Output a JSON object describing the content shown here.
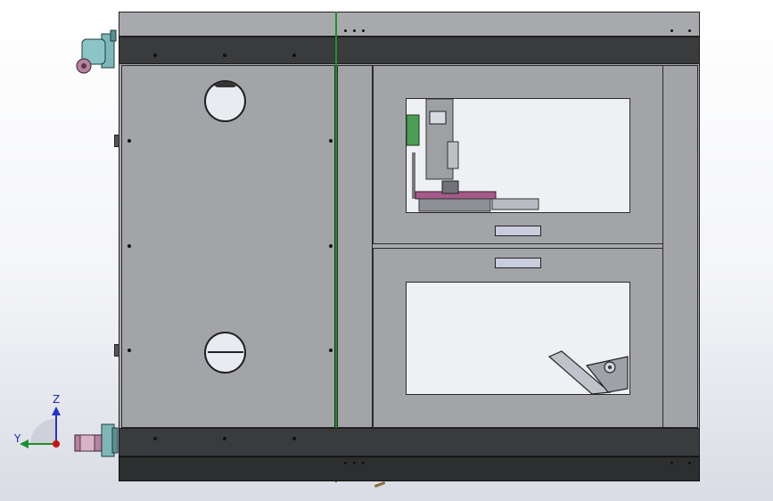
{
  "viewport": {
    "name": "cad-model-viewport"
  },
  "triad": {
    "z_label": "Z",
    "y_label": "Y",
    "colors": {
      "z": "#2233c8",
      "y": "#1c8d2a",
      "origin": "#cc1111"
    }
  },
  "colors": {
    "frame_dark": "#3a3b3d",
    "panel_gray": "#a3a4a7",
    "window_glass": "#eef0f4",
    "caster": "#7fb7b8",
    "caster_wheel": "#9a6a8a",
    "axis_green": "#1f8f2a"
  }
}
